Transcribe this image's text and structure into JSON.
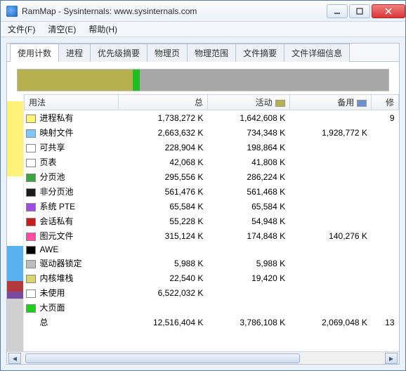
{
  "window": {
    "title": "RamMap - Sysinternals: www.sysinternals.com"
  },
  "menus": [
    "文件(F)",
    "清空(E)",
    "帮助(H)"
  ],
  "tabs": [
    "使用计数",
    "进程",
    "优先级摘要",
    "物理页",
    "物理范围",
    "文件摘要",
    "文件详细信息"
  ],
  "activeTab": 0,
  "columns": {
    "usage": "用法",
    "total": "总",
    "active": "活动",
    "standby": "备用",
    "modified": "修"
  },
  "legendColors": {
    "active": "#b7b04f",
    "standby": "#6b8fd0"
  },
  "distribution": [
    {
      "color": "#b7b04f",
      "pct": 31
    },
    {
      "color": "#1fbf1f",
      "pct": 2
    },
    {
      "color": "#a7a7a7",
      "pct": 67
    }
  ],
  "leftStrip": [
    {
      "color": "#fff27a",
      "pct": 30
    },
    {
      "color": "#ffffff",
      "pct": 28
    },
    {
      "color": "#5bb0ef",
      "pct": 14
    },
    {
      "color": "#b33a3a",
      "pct": 4
    },
    {
      "color": "#7a4aa0",
      "pct": 3
    },
    {
      "color": "#d0d0d0",
      "pct": 21
    }
  ],
  "rows": [
    {
      "color": "#fff27a",
      "name": "进程私有",
      "total": "1,738,272 K",
      "active": "1,642,608 K",
      "standby": "",
      "modified": "9"
    },
    {
      "color": "#7ec8ff",
      "name": "映射文件",
      "total": "2,663,632 K",
      "active": "734,348 K",
      "standby": "1,928,772 K",
      "modified": ""
    },
    {
      "color": "#ffffff",
      "name": "可共享",
      "total": "228,904 K",
      "active": "198,864 K",
      "standby": "",
      "modified": ""
    },
    {
      "color": "#ffffff",
      "name": "页表",
      "total": "42,068 K",
      "active": "41,808 K",
      "standby": "",
      "modified": ""
    },
    {
      "color": "#3fa33f",
      "name": "分页池",
      "total": "295,556 K",
      "active": "286,224 K",
      "standby": "",
      "modified": ""
    },
    {
      "color": "#1c1c1c",
      "name": "非分页池",
      "total": "561,476 K",
      "active": "561,468 K",
      "standby": "",
      "modified": ""
    },
    {
      "color": "#a14ee0",
      "name": "系统 PTE",
      "total": "65,584 K",
      "active": "65,584 K",
      "standby": "",
      "modified": ""
    },
    {
      "color": "#c41f1f",
      "name": "会话私有",
      "total": "55,228 K",
      "active": "54,948 K",
      "standby": "",
      "modified": ""
    },
    {
      "color": "#ff4fa3",
      "name": "图元文件",
      "total": "315,124 K",
      "active": "174,848 K",
      "standby": "140,276 K",
      "modified": ""
    },
    {
      "color": "#000000",
      "name": "AWE",
      "total": "",
      "active": "",
      "standby": "",
      "modified": ""
    },
    {
      "color": "#bdbdbd",
      "name": "驱动器锁定",
      "total": "5,988 K",
      "active": "5,988 K",
      "standby": "",
      "modified": ""
    },
    {
      "color": "#d9d574",
      "name": "内核堆栈",
      "total": "22,540 K",
      "active": "19,420 K",
      "standby": "",
      "modified": ""
    },
    {
      "color": "#ffffff",
      "name": "未使用",
      "total": "6,522,032 K",
      "active": "",
      "standby": "",
      "modified": ""
    },
    {
      "color": "#1fcf1f",
      "name": "大页面",
      "total": "",
      "active": "",
      "standby": "",
      "modified": ""
    }
  ],
  "totals": {
    "label": "总",
    "total": "12,516,404 K",
    "active": "3,786,108 K",
    "standby": "2,069,048 K",
    "modified": "13"
  },
  "chart_data": {
    "type": "table",
    "title": "RamMap 使用计数",
    "columns": [
      "用法",
      "总",
      "活动",
      "备用"
    ],
    "series": [
      {
        "name": "进程私有",
        "values": [
          1738272,
          1642608,
          null
        ]
      },
      {
        "name": "映射文件",
        "values": [
          2663632,
          734348,
          1928772
        ]
      },
      {
        "name": "可共享",
        "values": [
          228904,
          198864,
          null
        ]
      },
      {
        "name": "页表",
        "values": [
          42068,
          41808,
          null
        ]
      },
      {
        "name": "分页池",
        "values": [
          295556,
          286224,
          null
        ]
      },
      {
        "name": "非分页池",
        "values": [
          561476,
          561468,
          null
        ]
      },
      {
        "name": "系统 PTE",
        "values": [
          65584,
          65584,
          null
        ]
      },
      {
        "name": "会话私有",
        "values": [
          55228,
          54948,
          null
        ]
      },
      {
        "name": "图元文件",
        "values": [
          315124,
          174848,
          140276
        ]
      },
      {
        "name": "AWE",
        "values": [
          null,
          null,
          null
        ]
      },
      {
        "name": "驱动器锁定",
        "values": [
          5988,
          5988,
          null
        ]
      },
      {
        "name": "内核堆栈",
        "values": [
          22540,
          19420,
          null
        ]
      },
      {
        "name": "未使用",
        "values": [
          6522032,
          null,
          null
        ]
      },
      {
        "name": "大页面",
        "values": [
          null,
          null,
          null
        ]
      },
      {
        "name": "总",
        "values": [
          12516404,
          3786108,
          2069048
        ]
      }
    ],
    "unit": "K"
  }
}
